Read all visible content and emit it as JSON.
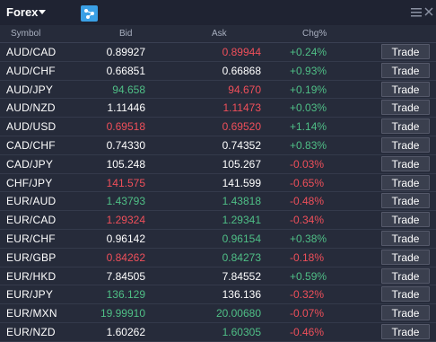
{
  "header": {
    "title": "Forex"
  },
  "columns": {
    "symbol": "Symbol",
    "bid": "Bid",
    "ask": "Ask",
    "chg": "Chg%"
  },
  "rows": [
    {
      "symbol": "AUD/CAD",
      "bid": "0.89927",
      "bid_color": "white",
      "ask": "0.89944",
      "ask_color": "red",
      "chg": "+0.24%",
      "chg_color": "green",
      "trade": "Trade"
    },
    {
      "symbol": "AUD/CHF",
      "bid": "0.66851",
      "bid_color": "white",
      "ask": "0.66868",
      "ask_color": "white",
      "chg": "+0.93%",
      "chg_color": "green",
      "trade": "Trade"
    },
    {
      "symbol": "AUD/JPY",
      "bid": "94.658",
      "bid_color": "green",
      "ask": "94.670",
      "ask_color": "red",
      "chg": "+0.19%",
      "chg_color": "green",
      "trade": "Trade"
    },
    {
      "symbol": "AUD/NZD",
      "bid": "1.11446",
      "bid_color": "white",
      "ask": "1.11473",
      "ask_color": "red",
      "chg": "+0.03%",
      "chg_color": "green",
      "trade": "Trade"
    },
    {
      "symbol": "AUD/USD",
      "bid": "0.69518",
      "bid_color": "red",
      "ask": "0.69520",
      "ask_color": "red",
      "chg": "+1.14%",
      "chg_color": "green",
      "trade": "Trade"
    },
    {
      "symbol": "CAD/CHF",
      "bid": "0.74330",
      "bid_color": "white",
      "ask": "0.74352",
      "ask_color": "white",
      "chg": "+0.83%",
      "chg_color": "green",
      "trade": "Trade"
    },
    {
      "symbol": "CAD/JPY",
      "bid": "105.248",
      "bid_color": "white",
      "ask": "105.267",
      "ask_color": "white",
      "chg": "-0.03%",
      "chg_color": "red",
      "trade": "Trade"
    },
    {
      "symbol": "CHF/JPY",
      "bid": "141.575",
      "bid_color": "red",
      "ask": "141.599",
      "ask_color": "white",
      "chg": "-0.65%",
      "chg_color": "red",
      "trade": "Trade"
    },
    {
      "symbol": "EUR/AUD",
      "bid": "1.43793",
      "bid_color": "green",
      "ask": "1.43818",
      "ask_color": "green",
      "chg": "-0.48%",
      "chg_color": "red",
      "trade": "Trade"
    },
    {
      "symbol": "EUR/CAD",
      "bid": "1.29324",
      "bid_color": "red",
      "ask": "1.29341",
      "ask_color": "green",
      "chg": "-0.34%",
      "chg_color": "red",
      "trade": "Trade"
    },
    {
      "symbol": "EUR/CHF",
      "bid": "0.96142",
      "bid_color": "white",
      "ask": "0.96154",
      "ask_color": "green",
      "chg": "+0.38%",
      "chg_color": "green",
      "trade": "Trade"
    },
    {
      "symbol": "EUR/GBP",
      "bid": "0.84262",
      "bid_color": "red",
      "ask": "0.84273",
      "ask_color": "green",
      "chg": "-0.18%",
      "chg_color": "red",
      "trade": "Trade"
    },
    {
      "symbol": "EUR/HKD",
      "bid": "7.84505",
      "bid_color": "white",
      "ask": "7.84552",
      "ask_color": "white",
      "chg": "+0.59%",
      "chg_color": "green",
      "trade": "Trade"
    },
    {
      "symbol": "EUR/JPY",
      "bid": "136.129",
      "bid_color": "green",
      "ask": "136.136",
      "ask_color": "white",
      "chg": "-0.32%",
      "chg_color": "red",
      "trade": "Trade"
    },
    {
      "symbol": "EUR/MXN",
      "bid": "19.99910",
      "bid_color": "green",
      "ask": "20.00680",
      "ask_color": "green",
      "chg": "-0.07%",
      "chg_color": "red",
      "trade": "Trade"
    },
    {
      "symbol": "EUR/NZD",
      "bid": "1.60262",
      "bid_color": "white",
      "ask": "1.60305",
      "ask_color": "green",
      "chg": "-0.46%",
      "chg_color": "red",
      "trade": "Trade"
    }
  ],
  "colors": {
    "background": "#262b3a",
    "header": "#1f2332",
    "green": "#4fbf86",
    "red": "#ef4f5a",
    "white": "#ffffff",
    "accent": "#3aa0e6"
  },
  "icons": {
    "title_dropdown": "caret-down-icon",
    "network_button": "network-icon",
    "menu": "hamburger-menu-icon",
    "close": "close-icon"
  }
}
